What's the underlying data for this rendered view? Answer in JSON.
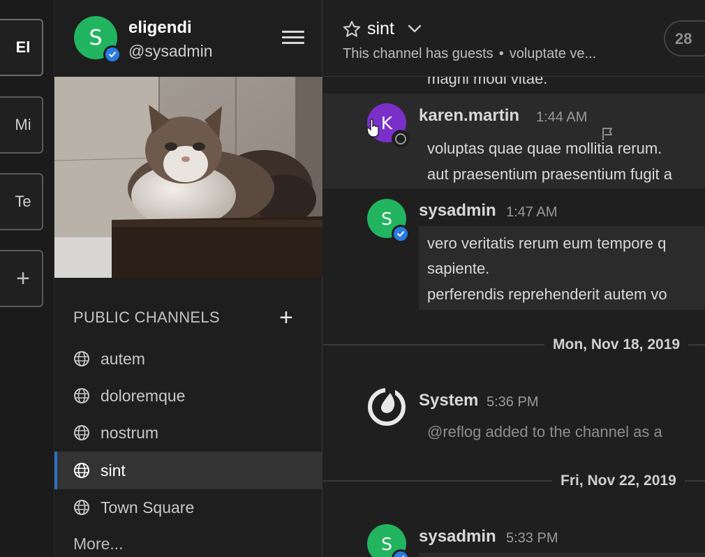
{
  "teams": [
    {
      "label": "El",
      "active": true
    },
    {
      "label": "Mi",
      "active": false
    },
    {
      "label": "Te",
      "active": false
    }
  ],
  "team_add_label": "+",
  "user": {
    "avatar_letter": "S",
    "display_name": "eligendi",
    "username": "@sysadmin",
    "avatar_color": "#22b45f"
  },
  "sidebar": {
    "section_title": "PUBLIC CHANNELS",
    "section_add": "+",
    "channels": [
      {
        "label": "autem",
        "active": false
      },
      {
        "label": "doloremque",
        "active": false
      },
      {
        "label": "nostrum",
        "active": false
      },
      {
        "label": "sint",
        "active": true
      },
      {
        "label": "Town Square",
        "active": false
      }
    ],
    "more_label": "More..."
  },
  "channel": {
    "name": "sint",
    "guest_note": "This channel has guests",
    "separator": "•",
    "purpose": "voluptate ve...",
    "member_count": "28"
  },
  "feed": {
    "cut_line": "magni modi vitae.",
    "posts": [
      {
        "avatar_letter": "K",
        "avatar_color": "#7b2fc9",
        "author": "karen.martin",
        "time": "1:44 AM",
        "lines": [
          "voluptas quae quae mollitia rerum.",
          "aut praesentium praesentium fugit a"
        ]
      },
      {
        "avatar_letter": "S",
        "avatar_color": "#22b45f",
        "author": "sysadmin",
        "time": "1:47 AM",
        "lines": [
          "vero veritatis rerum eum tempore q",
          "sapiente.",
          "perferendis reprehenderit autem vo"
        ]
      },
      {
        "author": "System",
        "time": "5:36 PM",
        "lines": [
          "@reflog added to the channel as a"
        ]
      },
      {
        "avatar_letter": "S",
        "avatar_color": "#22b45f",
        "author": "sysadmin",
        "time": "5:33 PM",
        "lines": []
      }
    ],
    "date_separators": [
      "Mon, Nov 18, 2019",
      "Fri, Nov 22, 2019"
    ]
  },
  "colors": {
    "accent": "#2e6fc4",
    "verified_badge": "#2a7be0",
    "background": "#1f1f1f"
  },
  "icons": [
    "hamburger-menu-icon",
    "globe-icon",
    "star-icon",
    "chevron-down-icon",
    "flag-icon",
    "verified-badge-icon",
    "status-offline-icon",
    "mattermost-logo-icon",
    "hand-cursor-icon"
  ]
}
